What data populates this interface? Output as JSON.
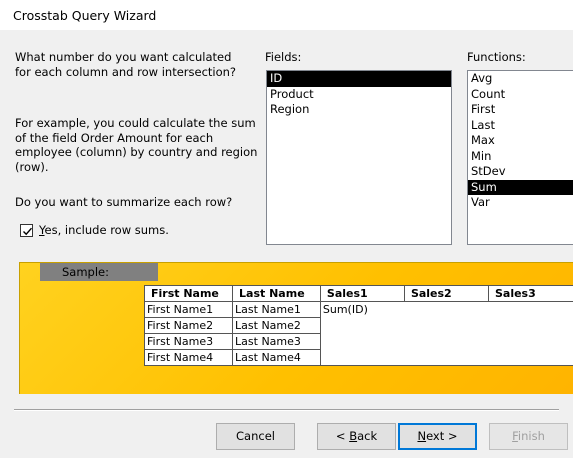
{
  "window": {
    "title": "Crosstab Query Wizard"
  },
  "instructions": {
    "question": "What number do you want calculated for each column and row intersection?",
    "example": "For example, you could calculate the sum of the field Order Amount for each employee (column)  by country and region (row).",
    "summarize_question": "Do you want to summarize each row?"
  },
  "row_sums": {
    "label": "Yes, include row sums.",
    "checked": true
  },
  "fields": {
    "label": "Fields:",
    "items": [
      "ID",
      "Product",
      "Region"
    ],
    "selected": "ID"
  },
  "functions": {
    "label": "Functions:",
    "items": [
      "Avg",
      "Count",
      "First",
      "Last",
      "Max",
      "Min",
      "StDev",
      "Sum",
      "Var"
    ],
    "selected": "Sum"
  },
  "sample": {
    "label": "Sample:",
    "headers": [
      "First Name",
      "Last Name",
      "Sales1",
      "Sales2",
      "Sales3"
    ],
    "rows": [
      [
        "First Name1",
        "Last Name1",
        "Sum(ID)"
      ],
      [
        "First Name2",
        "Last Name2",
        ""
      ],
      [
        "First Name3",
        "Last Name3",
        ""
      ],
      [
        "First Name4",
        "Last Name4",
        ""
      ]
    ]
  },
  "buttons": {
    "cancel": "Cancel",
    "back": "< Back",
    "next": "Next >",
    "finish": "Finish"
  },
  "colors": {
    "sample_background": "#ffc000",
    "selection": "#000000",
    "default_button_border": "#0078d7"
  }
}
